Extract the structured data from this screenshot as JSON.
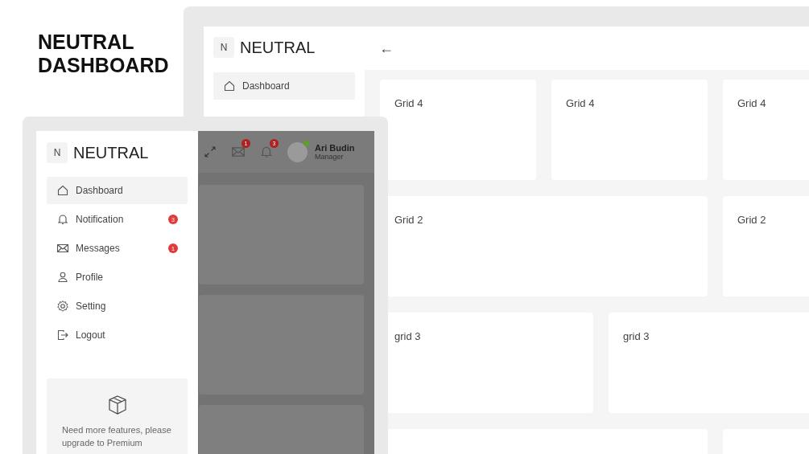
{
  "title": "NEUTRAL DASHBOARD",
  "back_window": {
    "logo": {
      "letter": "N",
      "name": "NEUTRAL"
    },
    "nav": [
      {
        "label": "Dashboard",
        "selected": true
      }
    ],
    "back_arrow": "←",
    "card_rows": [
      [
        {
          "label": "Grid 4",
          "kind": "quarter"
        },
        {
          "label": "Grid 4",
          "kind": "quarter"
        },
        {
          "label": "Grid 4",
          "kind": "quarter"
        }
      ],
      [
        {
          "label": "Grid 2",
          "kind": "half"
        },
        {
          "label": "Grid 2",
          "kind": "half"
        }
      ],
      [
        {
          "label": "grid 3",
          "kind": "third"
        },
        {
          "label": "grid 3",
          "kind": "third"
        }
      ],
      [
        {
          "kind": "half"
        },
        {
          "kind": "half"
        }
      ]
    ]
  },
  "front_window": {
    "logo": {
      "letter": "N",
      "name": "NEUTRAL"
    },
    "nav": [
      {
        "label": "Dashboard",
        "selected": true
      },
      {
        "label": "Notification",
        "selected": false,
        "badge": "3"
      },
      {
        "label": "Messages",
        "selected": false,
        "badge": "1"
      },
      {
        "label": "Profile",
        "selected": false
      },
      {
        "label": "Setting",
        "selected": false
      },
      {
        "label": "Logout",
        "selected": false
      }
    ],
    "promo": {
      "text": "Need more features, please upgrade to Premium"
    },
    "main_dimmed": true,
    "header": {
      "mail_badge": "1",
      "bell_badge": "3",
      "user": {
        "name": "Ari Budin",
        "role": "Manager",
        "online": true
      }
    }
  }
}
